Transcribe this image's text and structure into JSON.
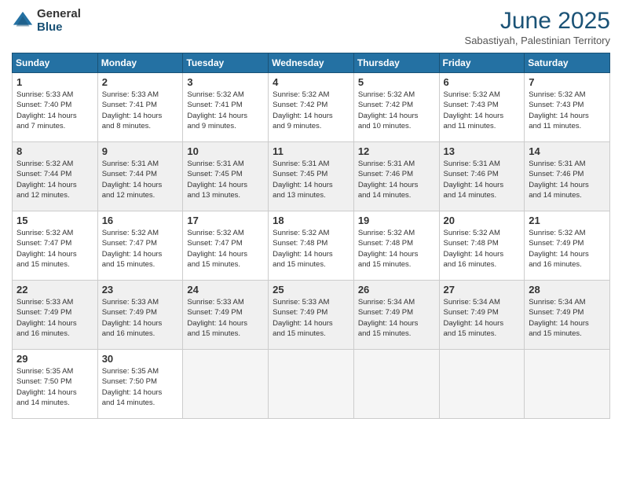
{
  "logo": {
    "general": "General",
    "blue": "Blue"
  },
  "title": "June 2025",
  "subtitle": "Sabastiyah, Palestinian Territory",
  "days_of_week": [
    "Sunday",
    "Monday",
    "Tuesday",
    "Wednesday",
    "Thursday",
    "Friday",
    "Saturday"
  ],
  "weeks": [
    [
      {
        "day": 1,
        "sunrise": "5:33 AM",
        "sunset": "7:40 PM",
        "daylight": "14 hours and 7 minutes."
      },
      {
        "day": 2,
        "sunrise": "5:33 AM",
        "sunset": "7:41 PM",
        "daylight": "14 hours and 8 minutes."
      },
      {
        "day": 3,
        "sunrise": "5:32 AM",
        "sunset": "7:41 PM",
        "daylight": "14 hours and 9 minutes."
      },
      {
        "day": 4,
        "sunrise": "5:32 AM",
        "sunset": "7:42 PM",
        "daylight": "14 hours and 9 minutes."
      },
      {
        "day": 5,
        "sunrise": "5:32 AM",
        "sunset": "7:42 PM",
        "daylight": "14 hours and 10 minutes."
      },
      {
        "day": 6,
        "sunrise": "5:32 AM",
        "sunset": "7:43 PM",
        "daylight": "14 hours and 11 minutes."
      },
      {
        "day": 7,
        "sunrise": "5:32 AM",
        "sunset": "7:43 PM",
        "daylight": "14 hours and 11 minutes."
      }
    ],
    [
      {
        "day": 8,
        "sunrise": "5:32 AM",
        "sunset": "7:44 PM",
        "daylight": "14 hours and 12 minutes."
      },
      {
        "day": 9,
        "sunrise": "5:31 AM",
        "sunset": "7:44 PM",
        "daylight": "14 hours and 12 minutes."
      },
      {
        "day": 10,
        "sunrise": "5:31 AM",
        "sunset": "7:45 PM",
        "daylight": "14 hours and 13 minutes."
      },
      {
        "day": 11,
        "sunrise": "5:31 AM",
        "sunset": "7:45 PM",
        "daylight": "14 hours and 13 minutes."
      },
      {
        "day": 12,
        "sunrise": "5:31 AM",
        "sunset": "7:46 PM",
        "daylight": "14 hours and 14 minutes."
      },
      {
        "day": 13,
        "sunrise": "5:31 AM",
        "sunset": "7:46 PM",
        "daylight": "14 hours and 14 minutes."
      },
      {
        "day": 14,
        "sunrise": "5:31 AM",
        "sunset": "7:46 PM",
        "daylight": "14 hours and 14 minutes."
      }
    ],
    [
      {
        "day": 15,
        "sunrise": "5:32 AM",
        "sunset": "7:47 PM",
        "daylight": "14 hours and 15 minutes."
      },
      {
        "day": 16,
        "sunrise": "5:32 AM",
        "sunset": "7:47 PM",
        "daylight": "14 hours and 15 minutes."
      },
      {
        "day": 17,
        "sunrise": "5:32 AM",
        "sunset": "7:47 PM",
        "daylight": "14 hours and 15 minutes."
      },
      {
        "day": 18,
        "sunrise": "5:32 AM",
        "sunset": "7:48 PM",
        "daylight": "14 hours and 15 minutes."
      },
      {
        "day": 19,
        "sunrise": "5:32 AM",
        "sunset": "7:48 PM",
        "daylight": "14 hours and 15 minutes."
      },
      {
        "day": 20,
        "sunrise": "5:32 AM",
        "sunset": "7:48 PM",
        "daylight": "14 hours and 16 minutes."
      },
      {
        "day": 21,
        "sunrise": "5:32 AM",
        "sunset": "7:49 PM",
        "daylight": "14 hours and 16 minutes."
      }
    ],
    [
      {
        "day": 22,
        "sunrise": "5:33 AM",
        "sunset": "7:49 PM",
        "daylight": "14 hours and 16 minutes."
      },
      {
        "day": 23,
        "sunrise": "5:33 AM",
        "sunset": "7:49 PM",
        "daylight": "14 hours and 16 minutes."
      },
      {
        "day": 24,
        "sunrise": "5:33 AM",
        "sunset": "7:49 PM",
        "daylight": "14 hours and 15 minutes."
      },
      {
        "day": 25,
        "sunrise": "5:33 AM",
        "sunset": "7:49 PM",
        "daylight": "14 hours and 15 minutes."
      },
      {
        "day": 26,
        "sunrise": "5:34 AM",
        "sunset": "7:49 PM",
        "daylight": "14 hours and 15 minutes."
      },
      {
        "day": 27,
        "sunrise": "5:34 AM",
        "sunset": "7:49 PM",
        "daylight": "14 hours and 15 minutes."
      },
      {
        "day": 28,
        "sunrise": "5:34 AM",
        "sunset": "7:49 PM",
        "daylight": "14 hours and 15 minutes."
      }
    ],
    [
      {
        "day": 29,
        "sunrise": "5:35 AM",
        "sunset": "7:50 PM",
        "daylight": "14 hours and 14 minutes."
      },
      {
        "day": 30,
        "sunrise": "5:35 AM",
        "sunset": "7:50 PM",
        "daylight": "14 hours and 14 minutes."
      },
      null,
      null,
      null,
      null,
      null
    ]
  ]
}
